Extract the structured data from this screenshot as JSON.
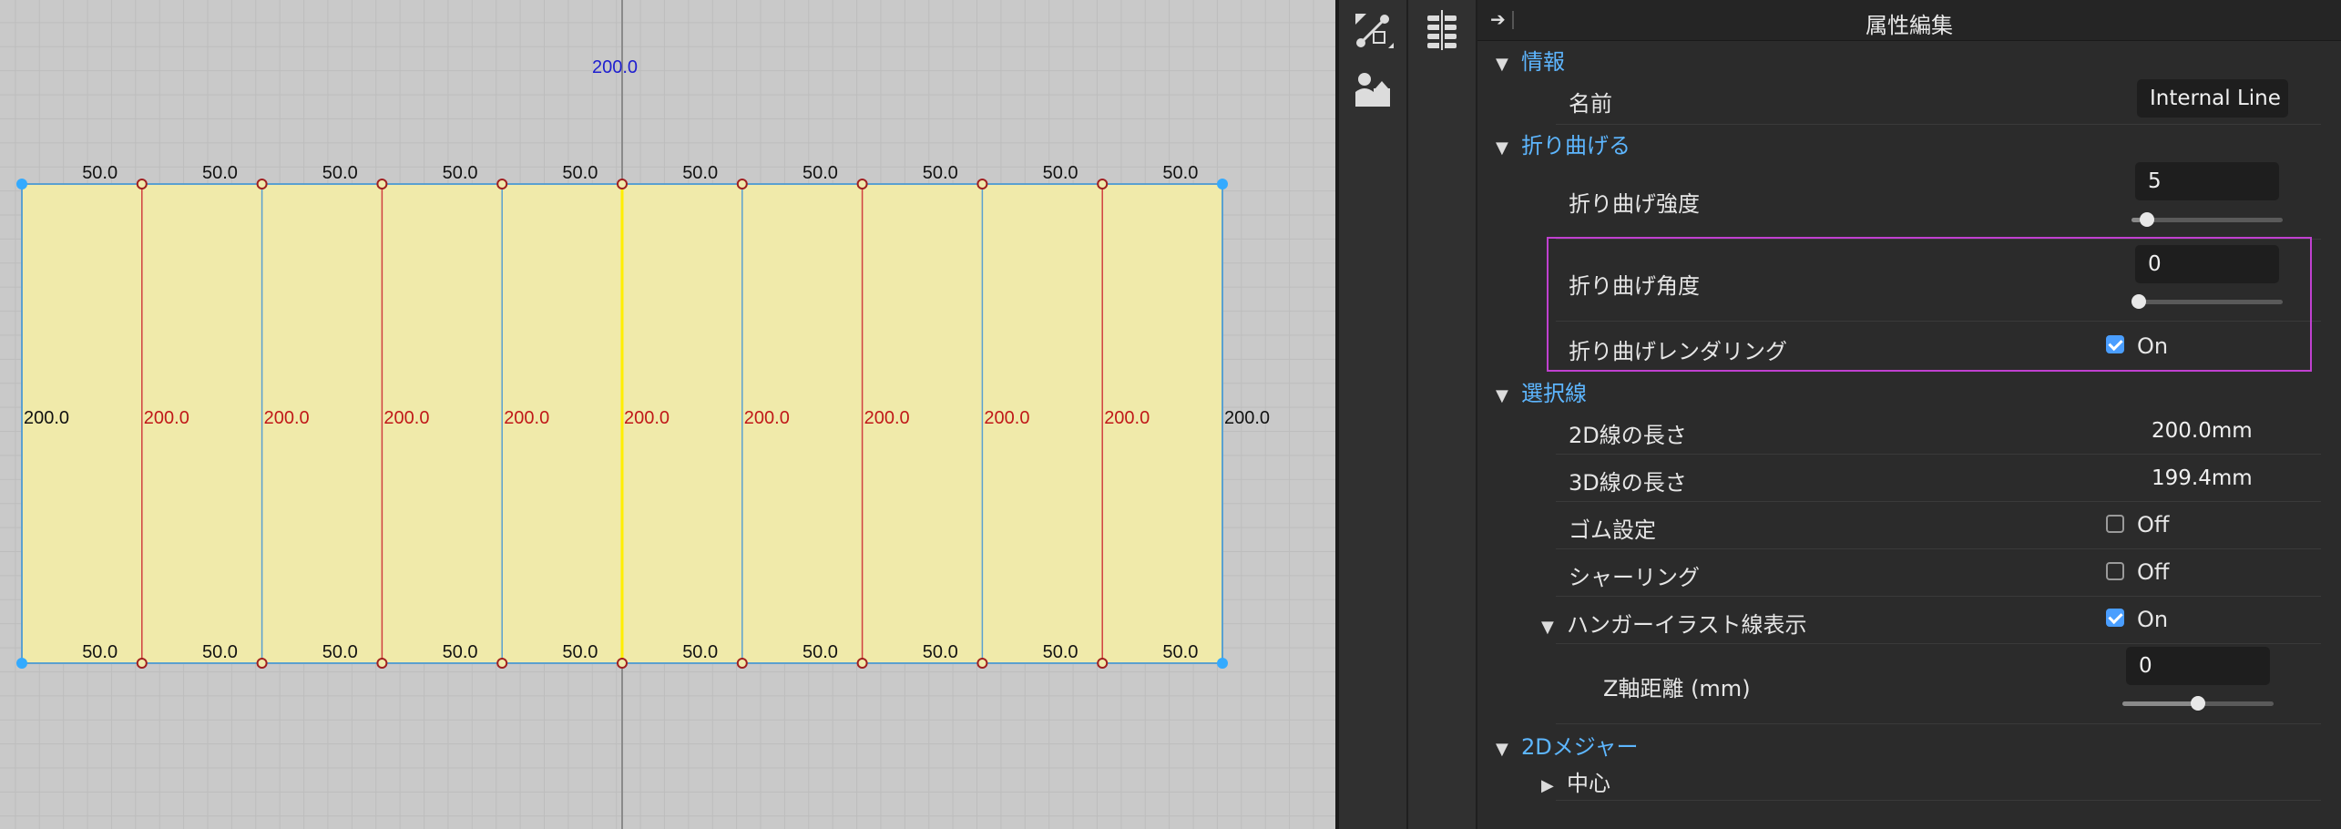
{
  "canvas": {
    "top_label": "200.0",
    "segment_labels": [
      "50.0",
      "50.0",
      "50.0",
      "50.0",
      "50.0",
      "50.0",
      "50.0",
      "50.0",
      "50.0",
      "50.0"
    ],
    "height_labels": [
      "200.0",
      "200.0",
      "200.0",
      "200.0",
      "200.0",
      "200.0",
      "200.0",
      "200.0",
      "200.0",
      "200.0",
      "200.0"
    ],
    "colors": {
      "fill": "#f0eaaa",
      "red_line": "#d04040",
      "blue_line": "#5aa0d0",
      "yellow_line": "#ffee00",
      "corner": "#33aaff"
    }
  },
  "tools": {
    "tool1": "transform-tool-icon",
    "tool2": "avatar-tool-icon",
    "tool3": "layers-icon"
  },
  "panel": {
    "title": "属性編集",
    "sections": {
      "info": {
        "label": "情報",
        "name_label": "名前",
        "name_value": "Internal Line"
      },
      "fold": {
        "label": "折り曲げる",
        "strength_label": "折り曲げ強度",
        "strength_value": "5",
        "strength_level": 0.06,
        "angle_label": "折り曲げ角度",
        "angle_value": "0",
        "angle_level": 0.0,
        "render_label": "折り曲げレンダリング",
        "render_state": "On"
      },
      "selected": {
        "label": "選択線",
        "len2d_label": "2D線の長さ",
        "len2d_value": "200.0mm",
        "len3d_label": "3D線の長さ",
        "len3d_value": "199.4mm",
        "rubber_label": "ゴム設定",
        "rubber_state": "Off",
        "shirring_label": "シャーリング",
        "shirring_state": "Off",
        "hanger_label": "ハンガーイラスト線表示",
        "hanger_state": "On",
        "z_label": "Z軸距離 (mm)",
        "z_value": "0",
        "z_level": 0.5
      },
      "measure": {
        "label": "2Dメジャー",
        "center_label": "中心"
      }
    }
  }
}
